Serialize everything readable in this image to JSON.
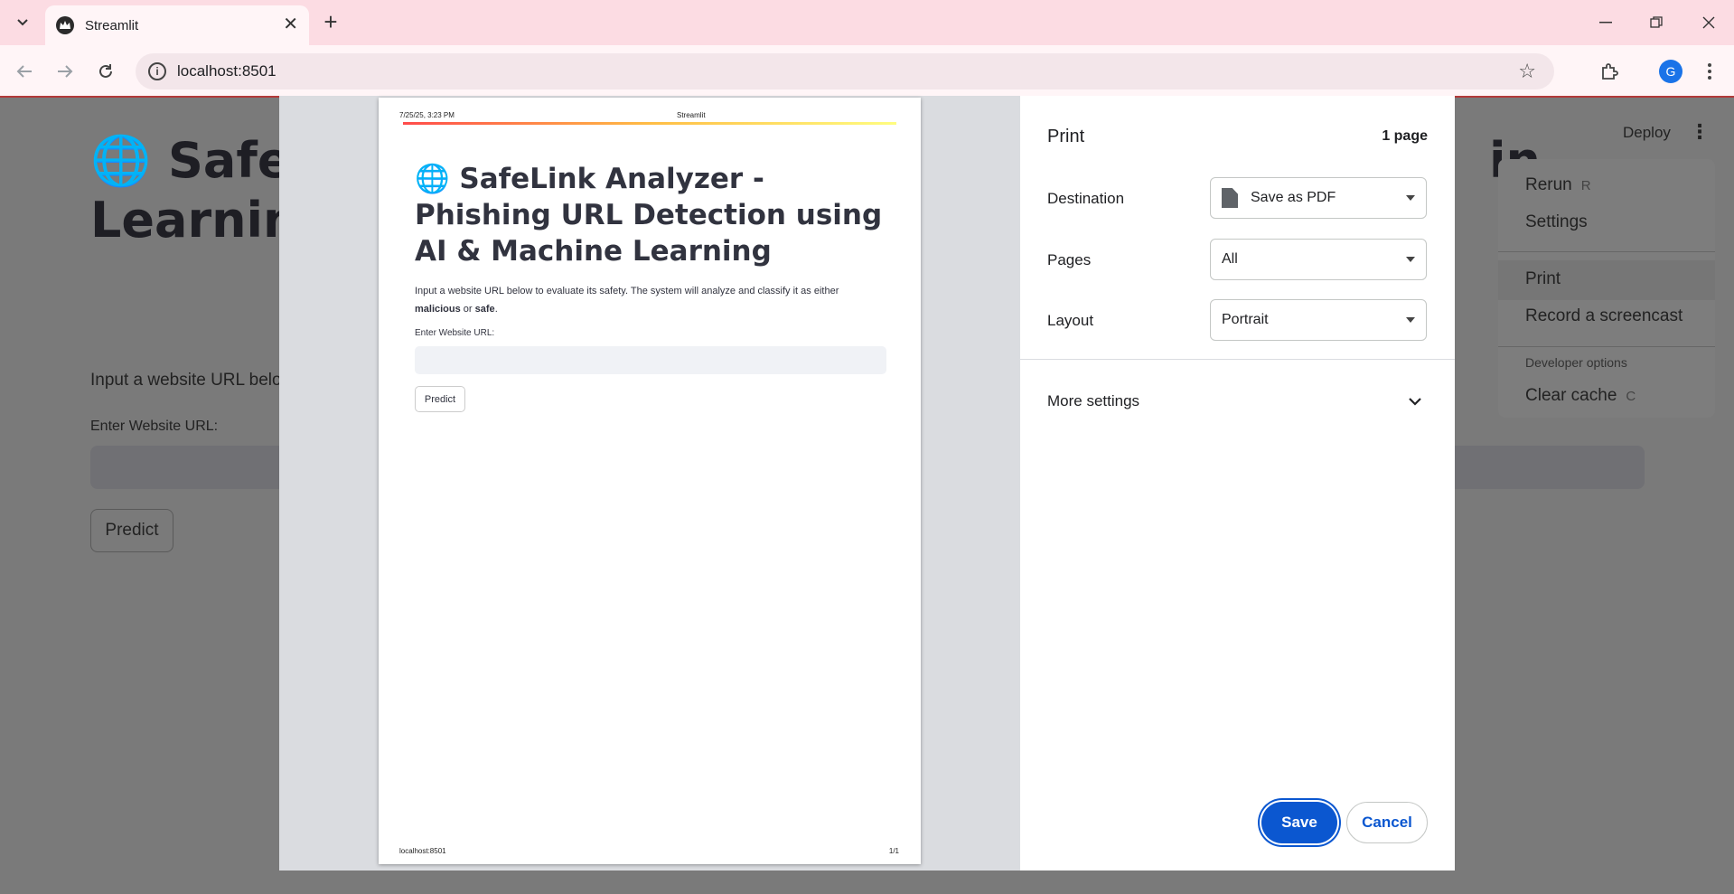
{
  "browser": {
    "tab_title": "Streamlit",
    "url": "localhost:8501"
  },
  "app": {
    "title_visible_start": "🌐 SafeL",
    "title_visible_end": "in",
    "title_line2": "Learning",
    "description_visible": "Input a website URL belo",
    "input_label": "Enter Website URL:",
    "predict_label": "Predict",
    "deploy_label": "Deploy"
  },
  "menu": {
    "rerun": "Rerun",
    "rerun_shortcut": "R",
    "settings": "Settings",
    "print": "Print",
    "record": "Record a screencast",
    "developer_options": "Developer options",
    "clear_cache": "Clear cache",
    "clear_cache_shortcut": "C"
  },
  "preview": {
    "header_date": "7/25/25, 3:23 PM",
    "header_title": "Streamlit",
    "title": "🌐 SafeLink Analyzer - Phishing URL Detection using AI & Machine Learning",
    "desc_part1": "Input a website URL below to evaluate its safety. The system will analyze and classify it as either ",
    "desc_bold1": "malicious",
    "desc_or": " or ",
    "desc_bold2": "safe",
    "desc_end": ".",
    "input_label": "Enter Website URL:",
    "predict_label": "Predict",
    "footer_url": "localhost:8501",
    "footer_page": "1/1"
  },
  "print_dialog": {
    "title": "Print",
    "page_count": "1 page",
    "destination_label": "Destination",
    "destination_value": "Save as PDF",
    "pages_label": "Pages",
    "pages_value": "All",
    "layout_label": "Layout",
    "layout_value": "Portrait",
    "more_settings": "More settings",
    "save": "Save",
    "cancel": "Cancel"
  },
  "colors": {
    "accent_blue": "#0b57d0",
    "tab_strip": "#fcdce3"
  }
}
